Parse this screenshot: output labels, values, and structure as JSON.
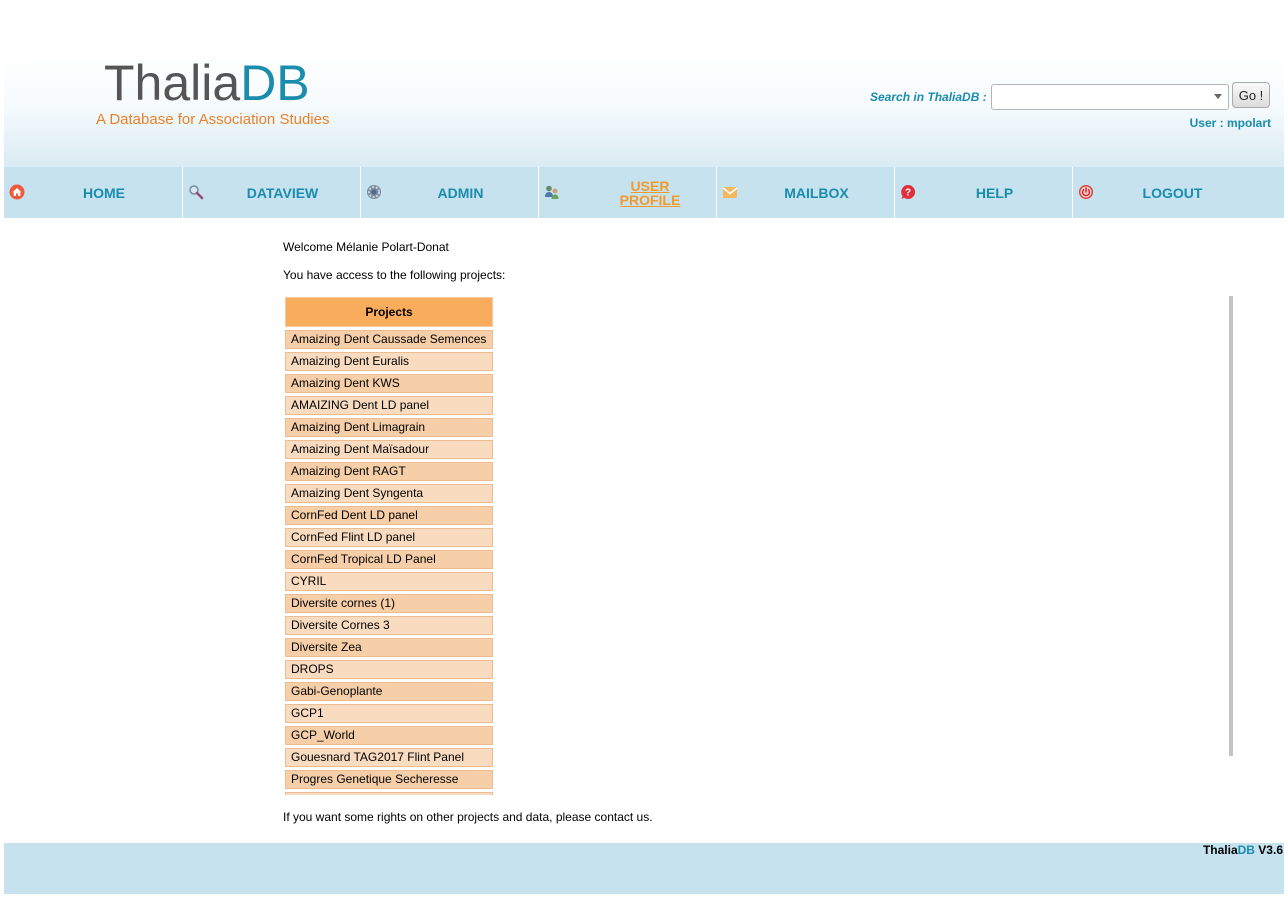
{
  "header": {
    "logo_part1": "Thalia",
    "logo_part2": "DB",
    "tagline": "A Database for Association Studies",
    "search_label": "Search in ThaliaDB :",
    "search_value": "",
    "go_label": "Go !",
    "user_label": "User :",
    "user_name": "mpolart"
  },
  "nav": [
    {
      "label": "HOME",
      "icon": "home-icon",
      "active": false
    },
    {
      "label": "DATAVIEW",
      "icon": "magnifier-icon",
      "active": false
    },
    {
      "label": "ADMIN",
      "icon": "gear-icon",
      "active": false
    },
    {
      "label": "USER PROFILE",
      "icon": "users-icon",
      "active": true
    },
    {
      "label": "MAILBOX",
      "icon": "envelope-icon",
      "active": false
    },
    {
      "label": "HELP",
      "icon": "help-icon",
      "active": false
    },
    {
      "label": "LOGOUT",
      "icon": "power-icon",
      "active": false
    }
  ],
  "main": {
    "welcome": "Welcome Mélanie Polart-Donat",
    "access_text": "You have access to the following projects:",
    "projects_header": "Projects",
    "projects": [
      "Amaizing Dent Caussade Semences",
      "Amaizing Dent Euralis",
      "Amaizing Dent KWS",
      "AMAIZING Dent LD panel",
      "Amaizing Dent Limagrain",
      "Amaizing Dent Maïsadour",
      "Amaizing Dent RAGT",
      "Amaizing Dent Syngenta",
      "CornFed Dent LD panel",
      "CornFed Flint LD panel",
      "CornFed Tropical LD Panel",
      "CYRIL",
      "Diversite cornes (1)",
      "Diversite Cornes 3",
      "Diversite Zea",
      "DROPS",
      "Gabi-Genoplante",
      "GCP1",
      "GCP_World",
      "Gouesnard TAG2017 Flint Panel",
      "Progres Genetique Secheresse",
      ""
    ],
    "contact_text": "If you want some rights on other projects and data, please contact us."
  },
  "footer": {
    "brand_part1": "Thalia",
    "brand_part2": "DB",
    "version": " V3.6"
  },
  "colors": {
    "brand_blue": "#1a8cad",
    "accent_orange": "#e8822a",
    "nav_bg": "#c5e2ee",
    "table_header": "#f9ac5c",
    "row_dark": "#f6cfa8",
    "row_light": "#f9dcc0"
  }
}
